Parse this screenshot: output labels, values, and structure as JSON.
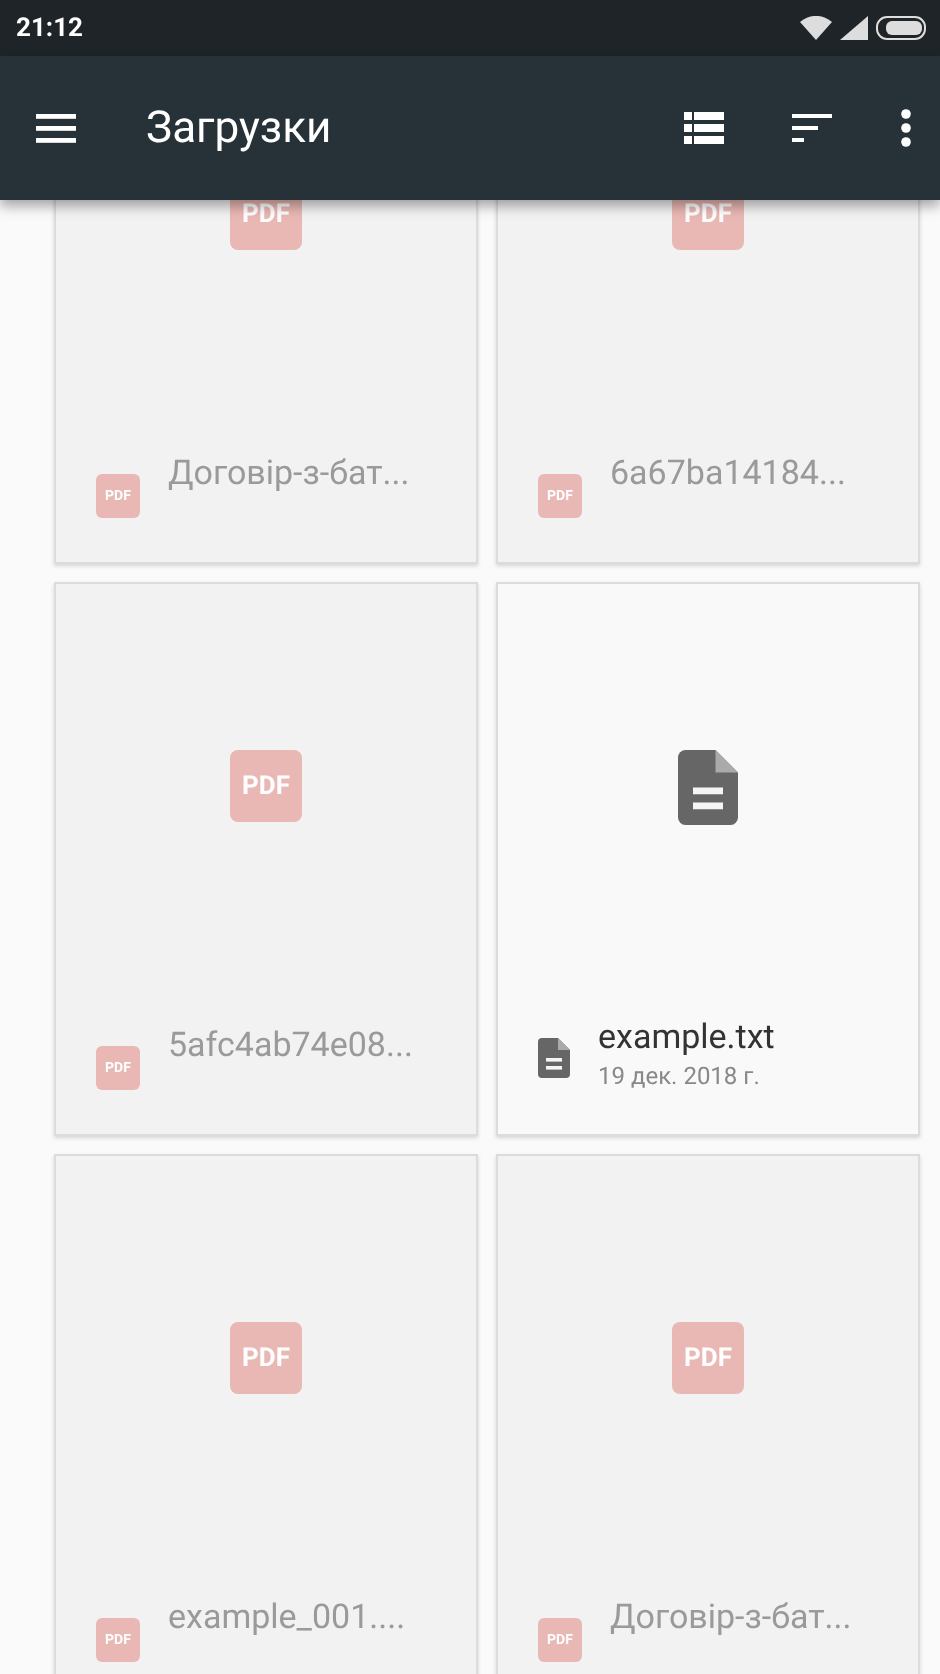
{
  "status_bar": {
    "time": "21:12"
  },
  "app_bar": {
    "title": "Загрузки"
  },
  "files": [
    {
      "kind": "pdf",
      "name": "Договір-з-бат...",
      "thumb_label": "PDF",
      "icon_label": "PDF",
      "disabled": true
    },
    {
      "kind": "pdf",
      "name": "6a67ba14184...",
      "thumb_label": "PDF",
      "icon_label": "PDF",
      "disabled": true
    },
    {
      "kind": "pdf",
      "name": "5afc4ab74e08...",
      "thumb_label": "PDF",
      "icon_label": "PDF",
      "disabled": true
    },
    {
      "kind": "text",
      "name": "example.txt",
      "date": "19 дек. 2018 г.",
      "disabled": false
    },
    {
      "kind": "pdf",
      "name": "example_001....",
      "thumb_label": "PDF",
      "icon_label": "PDF",
      "disabled": true
    },
    {
      "kind": "pdf",
      "name": "Договір-з-бат...",
      "thumb_label": "PDF",
      "icon_label": "PDF",
      "disabled": true
    }
  ]
}
